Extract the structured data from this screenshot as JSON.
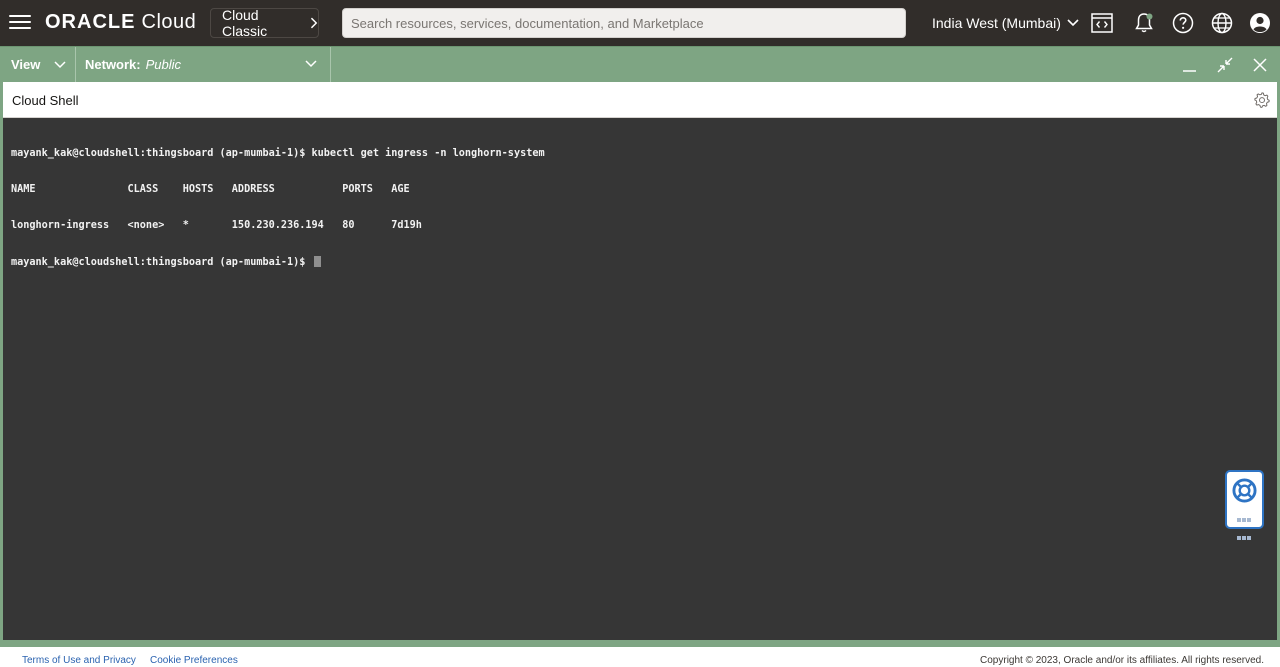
{
  "header": {
    "logo_brand": "ORACLE",
    "logo_product": "Cloud",
    "classic_label": "Cloud Classic",
    "search_placeholder": "Search resources, services, documentation, and Marketplace",
    "region": "India West (Mumbai)",
    "icons": [
      "hamburger-menu-icon",
      "code-editor-icon",
      "bell-icon",
      "help-icon",
      "globe-icon",
      "profile-icon"
    ]
  },
  "panel": {
    "view_label": "View",
    "network_label": "Network:",
    "network_value": "Public",
    "icons": [
      "minimize-icon",
      "restore-icon",
      "close-icon"
    ]
  },
  "shell": {
    "title": "Cloud Shell",
    "lines": [
      "mayank_kak@cloudshell:thingsboard (ap-mumbai-1)$ kubectl get ingress -n longhorn-system",
      "NAME               CLASS    HOSTS   ADDRESS           PORTS   AGE",
      "longhorn-ingress   <none>   *       150.230.236.194   80      7d19h",
      "mayank_kak@cloudshell:thingsboard (ap-mumbai-1)$ "
    ]
  },
  "footer": {
    "terms": "Terms of Use and Privacy",
    "cookies": "Cookie Preferences",
    "copyright": "Copyright © 2023, Oracle and/or its affiliates. All rights reserved."
  },
  "colors": {
    "header_bg": "#312d2a",
    "panel_green": "#7ea583",
    "terminal_bg": "#363636",
    "link_blue": "#2b63b0",
    "help_blue": "#2e74c4"
  }
}
